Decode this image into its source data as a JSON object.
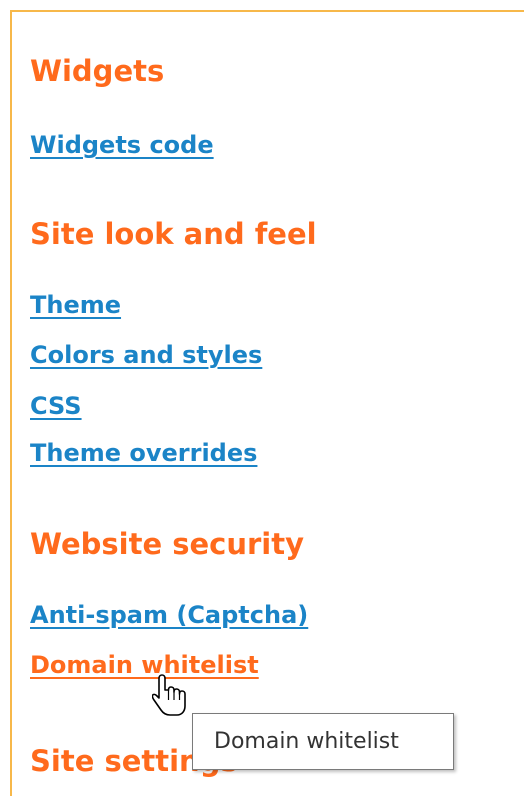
{
  "sections": [
    {
      "heading": "Widgets",
      "links": [
        "Widgets code"
      ]
    },
    {
      "heading": "Site look and feel",
      "links": [
        "Theme",
        "Colors and styles",
        "CSS",
        "Theme overrides"
      ]
    },
    {
      "heading": "Website security",
      "links": [
        "Anti-spam (Captcha)",
        "Domain whitelist"
      ]
    },
    {
      "heading": "Site settings",
      "links": []
    }
  ],
  "tooltip": {
    "text": "Domain whitelist"
  },
  "cursor": {
    "icon": "hand-pointer-icon"
  },
  "colors": {
    "heading": "#ff6a1c",
    "link": "#1b84c7",
    "link_hover": "#ff6a1c",
    "panel_border": "#f7b84a"
  }
}
